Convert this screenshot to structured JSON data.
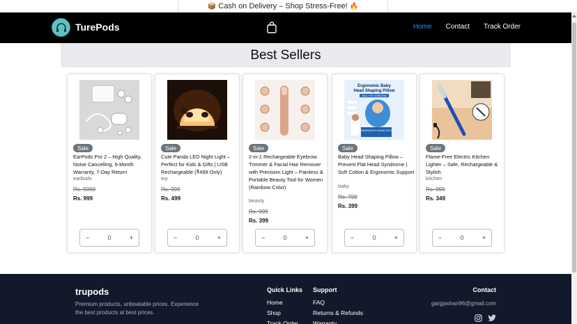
{
  "announcement": {
    "text": "Cash on Delivery – Shop Stress-Free!",
    "icon_left": "📦",
    "icon_right": "🔥"
  },
  "nav": {
    "brand": "TurePods",
    "links": [
      {
        "label": "Home",
        "active": true
      },
      {
        "label": "Contact",
        "active": false
      },
      {
        "label": "Track Order",
        "active": false
      }
    ]
  },
  "section": {
    "title": "Best Sellers"
  },
  "products": [
    {
      "badge": "Sale",
      "name": "EarPods Pro 2 – High Quality, Noise Cancelling, 6-Month Warranty, 7-Day Return",
      "category": "earbuds",
      "old_price": "Rs. 5000",
      "price": "Rs. 999",
      "qty": "0"
    },
    {
      "badge": "Sale",
      "name": "Cute Panda LED Night Light – Perfect for Kids & Gifts | USB Rechargeable (₹499 Only)",
      "category": "toy",
      "old_price": "Rs. 999",
      "price": "Rs. 499",
      "qty": "0"
    },
    {
      "badge": "Sale",
      "name": "2-in-1 Rechargeable Eyebrow Trimmer & Facial Hair Remover with Precision Light – Painless & Portable Beauty Tool for Women (Rainbow Color)",
      "category": "beauty",
      "old_price": "Rs. 999",
      "price": "Rs. 399",
      "qty": "0"
    },
    {
      "badge": "Sale",
      "name": "Baby Head Shaping Pillow – Prevent Flat Head Syndrome | Soft Cotton & Ergonomic Support",
      "category": "baby",
      "old_price": "Rs. 799",
      "price": "Rs. 399",
      "qty": "0"
    },
    {
      "badge": "Sale",
      "name": "Flame-Free Electric Kitchen Lighter – Safe, Rechargeable & Stylish",
      "category": "kitchen",
      "old_price": "Rs. 999",
      "price": "Rs. 349",
      "qty": "0"
    }
  ],
  "pillow_image": {
    "line1": "Ergonomic Baby",
    "line2": "Head Shaping Pillow",
    "band": "IDEAL FOR NEWBORNS",
    "badge": "RECOMMENDED BY INDIAN DOCTORS"
  },
  "footer": {
    "brand": "trupods",
    "tagline": "Premium products, unbeatable prices. Experience the best products at best prices.",
    "quick_links": {
      "title": "Quick Links",
      "items": [
        "Home",
        "Shop",
        "Track Order"
      ]
    },
    "support": {
      "title": "Support",
      "items": [
        "FAQ",
        "Returns & Refunds",
        "Warranty"
      ]
    },
    "contact": {
      "title": "Contact",
      "email": "gargjashan96@gmail.com"
    }
  },
  "colors": {
    "accent": "#2b8cff",
    "navbar": "#000000",
    "footer": "#12192b",
    "badge": "#6c757d",
    "logo": "#5fc1c1"
  },
  "icons": {
    "cart": "shopping-bag-icon",
    "social": [
      "instagram-icon",
      "twitter-icon"
    ]
  }
}
